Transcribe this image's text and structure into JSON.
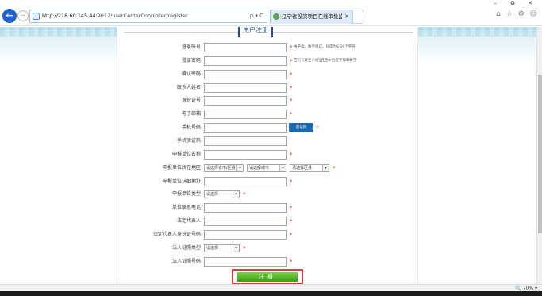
{
  "window": {
    "minimize": "–",
    "restore": "⧉",
    "close": "✕"
  },
  "address_bar": {
    "url_host": "http://218.60.145.44",
    "url_rest": ":9012/userCenterController/register",
    "tools": "ρ ▾ C"
  },
  "tab": {
    "title": "辽宁省投资项目在线审批监..."
  },
  "chrome_icons": "⌂ ☆ ⚙ ☺",
  "form": {
    "legend": "用户注册",
    "fields": [
      {
        "label": "登录账号",
        "hint": "由字母、数字组成，长度为6-20个字符",
        "required": true
      },
      {
        "label": "登录密码",
        "hint": "密码长度至少8位且至少包含字母和数字",
        "required": true
      },
      {
        "label": "确认密码",
        "required": true
      },
      {
        "label": "联系人姓名",
        "required": true
      },
      {
        "label": "身份证号",
        "required": true
      },
      {
        "label": "电子邮箱",
        "required": true
      },
      {
        "label": "手机号码",
        "button": "验证码",
        "required": true
      },
      {
        "label": "手机验证码",
        "required": false
      },
      {
        "label": "申报单位名称",
        "required": true
      },
      {
        "label": "申报单位所在地区",
        "selects": [
          "请选择省市/区县",
          "请选择城市",
          "请选择区县"
        ],
        "required": true
      },
      {
        "label": "申报单位详细地址",
        "required": true
      },
      {
        "label": "申报单位类型",
        "selects": [
          "请选择"
        ],
        "required": true
      },
      {
        "label": "单位联系电话",
        "required": true
      },
      {
        "label": "法定代表人",
        "required": true
      },
      {
        "label": "法定代表人身份证号码",
        "required": true
      },
      {
        "label": "法人证照类型",
        "selects": [
          "请选择"
        ],
        "required": true
      },
      {
        "label": "法人证照号码",
        "required": true
      }
    ],
    "submit_label": "注册"
  },
  "status_bar": {
    "zoom": "🔍 70% ▾"
  },
  "colors": {
    "accent": "#1a6bb3",
    "required": "#e02020",
    "submit": "#4ea61c",
    "highlight_border": "#e03a3a"
  }
}
